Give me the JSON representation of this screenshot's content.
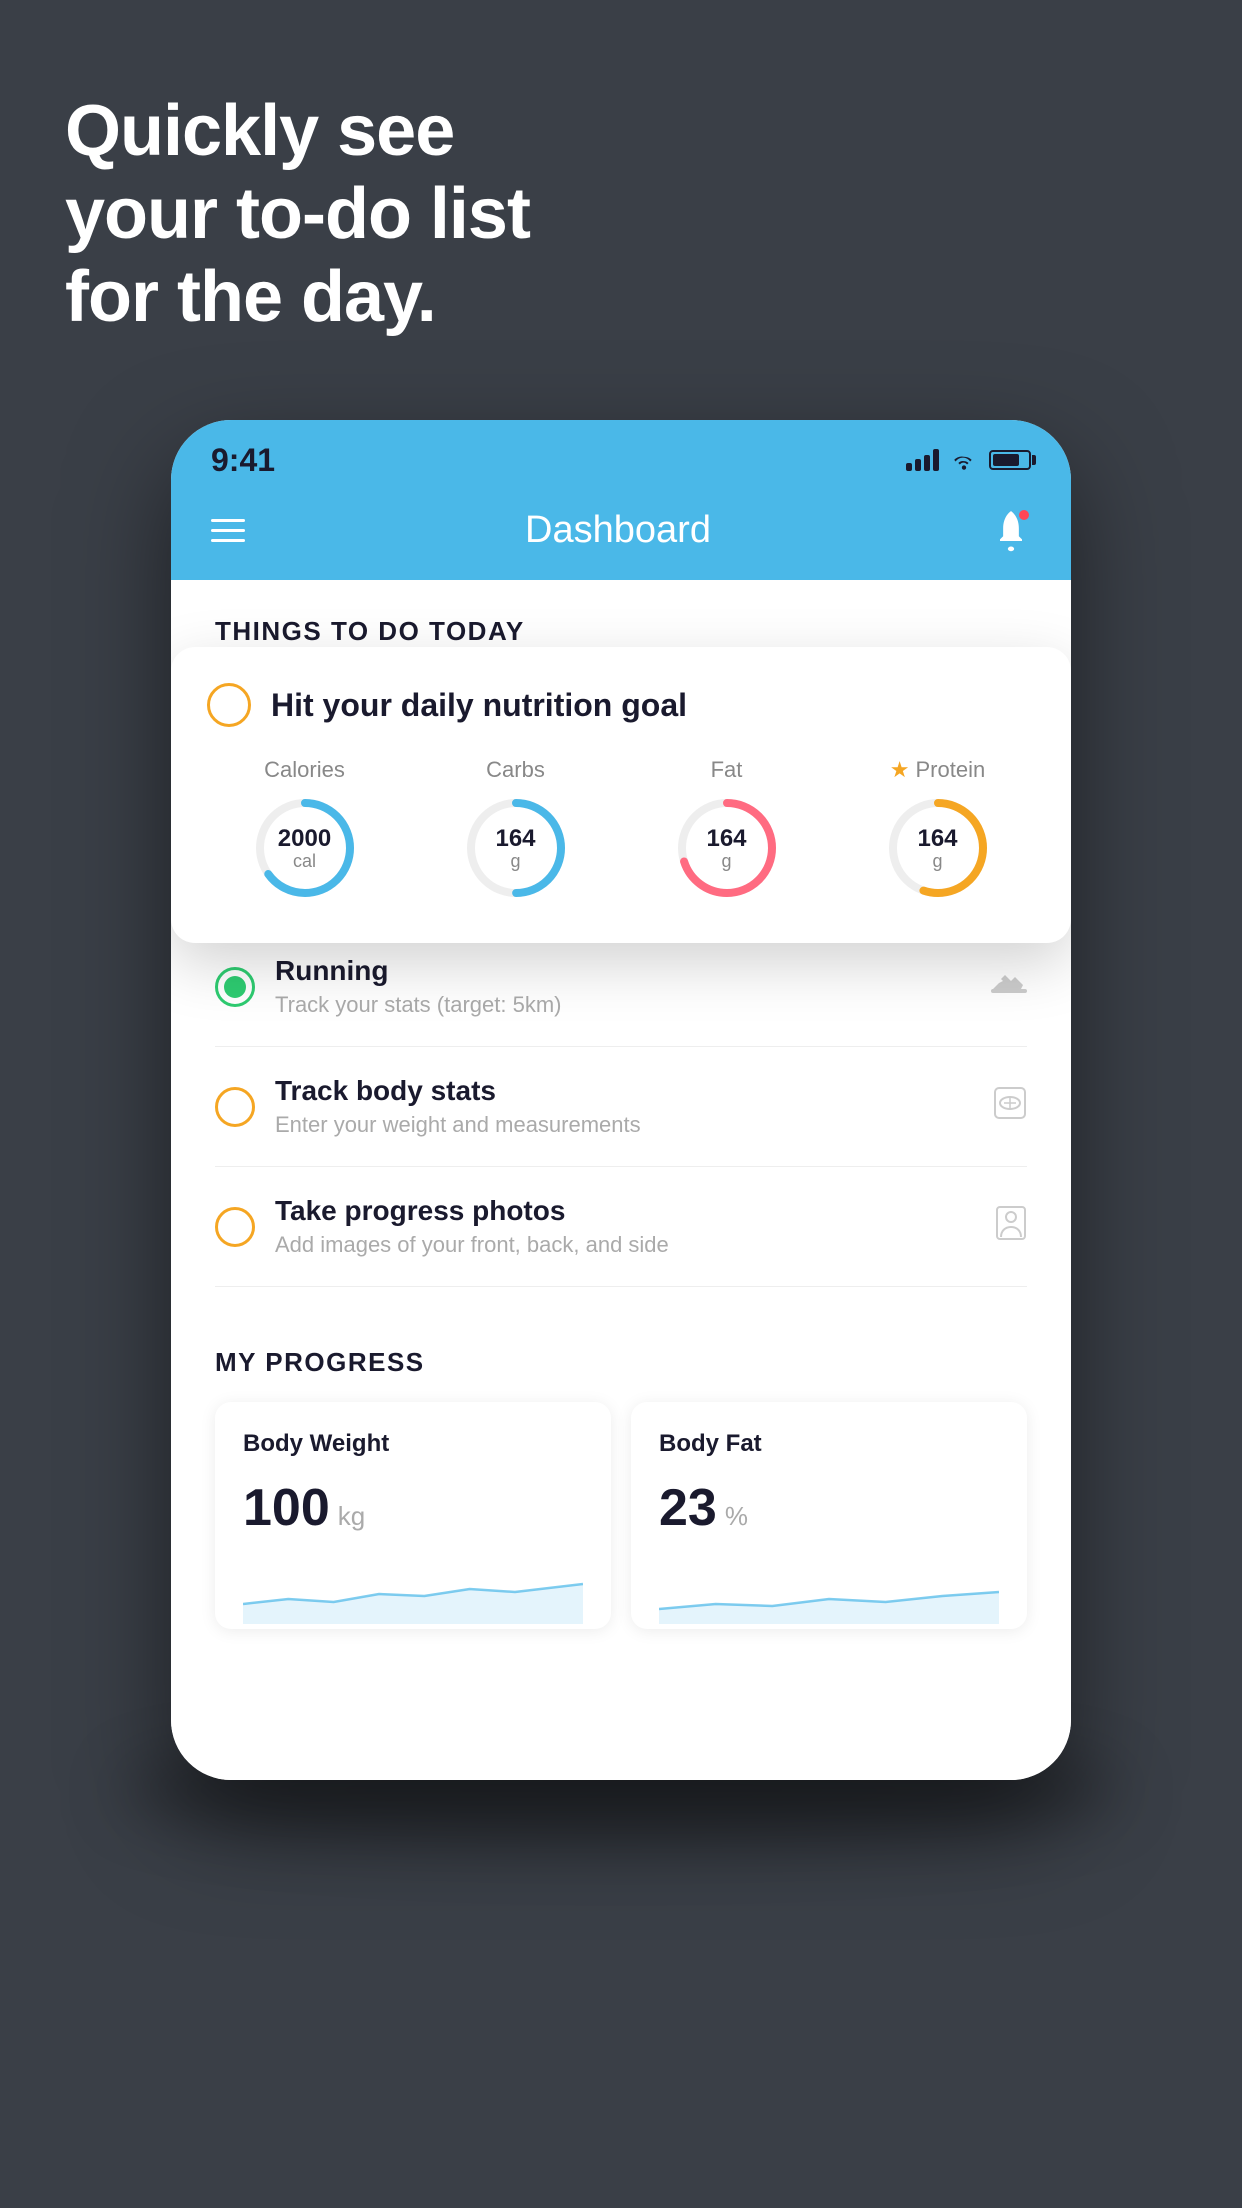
{
  "background": {
    "color": "#3a3f47"
  },
  "headline": {
    "line1": "Quickly see",
    "line2": "your to-do list",
    "line3": "for the day."
  },
  "status_bar": {
    "time": "9:41",
    "signal": "signal",
    "wifi": "wifi",
    "battery": "battery"
  },
  "header": {
    "title": "Dashboard",
    "menu_label": "menu",
    "notification_label": "notifications"
  },
  "things_section": {
    "title": "THINGS TO DO TODAY"
  },
  "featured_card": {
    "title": "Hit your daily nutrition goal",
    "nutrition": [
      {
        "label": "Calories",
        "value": "2000",
        "unit": "cal",
        "color": "#4ab8e8",
        "progress": 0.65,
        "starred": false
      },
      {
        "label": "Carbs",
        "value": "164",
        "unit": "g",
        "color": "#4ab8e8",
        "progress": 0.5,
        "starred": false
      },
      {
        "label": "Fat",
        "value": "164",
        "unit": "g",
        "color": "#ff6b81",
        "progress": 0.7,
        "starred": false
      },
      {
        "label": "Protein",
        "value": "164",
        "unit": "g",
        "color": "#f5a623",
        "progress": 0.55,
        "starred": true
      }
    ]
  },
  "todo_items": [
    {
      "id": "running",
      "title": "Running",
      "subtitle": "Track your stats (target: 5km)",
      "status": "green",
      "icon": "shoe"
    },
    {
      "id": "body-stats",
      "title": "Track body stats",
      "subtitle": "Enter your weight and measurements",
      "status": "yellow",
      "icon": "scale"
    },
    {
      "id": "progress-photos",
      "title": "Take progress photos",
      "subtitle": "Add images of your front, back, and side",
      "status": "yellow",
      "icon": "person"
    }
  ],
  "progress_section": {
    "title": "MY PROGRESS",
    "cards": [
      {
        "id": "body-weight",
        "title": "Body Weight",
        "value": "100",
        "unit": "kg"
      },
      {
        "id": "body-fat",
        "title": "Body Fat",
        "value": "23",
        "unit": "%"
      }
    ]
  }
}
